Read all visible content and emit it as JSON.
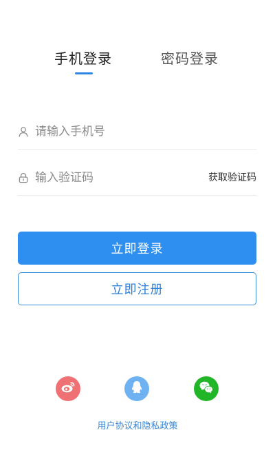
{
  "tabs": {
    "phone_login": "手机登录",
    "password_login": "密码登录",
    "active": "phone_login"
  },
  "phone_field": {
    "icon": "user-icon",
    "placeholder": "请输入手机号",
    "value": ""
  },
  "code_field": {
    "icon": "lock-icon",
    "placeholder": "输入验证码",
    "value": "",
    "get_code_label": "获取验证码"
  },
  "buttons": {
    "login_label": "立即登录",
    "register_label": "立即注册"
  },
  "social": [
    {
      "icon": "weibo-icon",
      "color": "#ef7173"
    },
    {
      "icon": "qq-icon",
      "color": "#6fb2f2"
    },
    {
      "icon": "wechat-icon",
      "color": "#20b627"
    }
  ],
  "policy_link": "用户协议和隐私政策",
  "colors": {
    "accent": "#2e8ff0",
    "link": "#3a87d6"
  }
}
